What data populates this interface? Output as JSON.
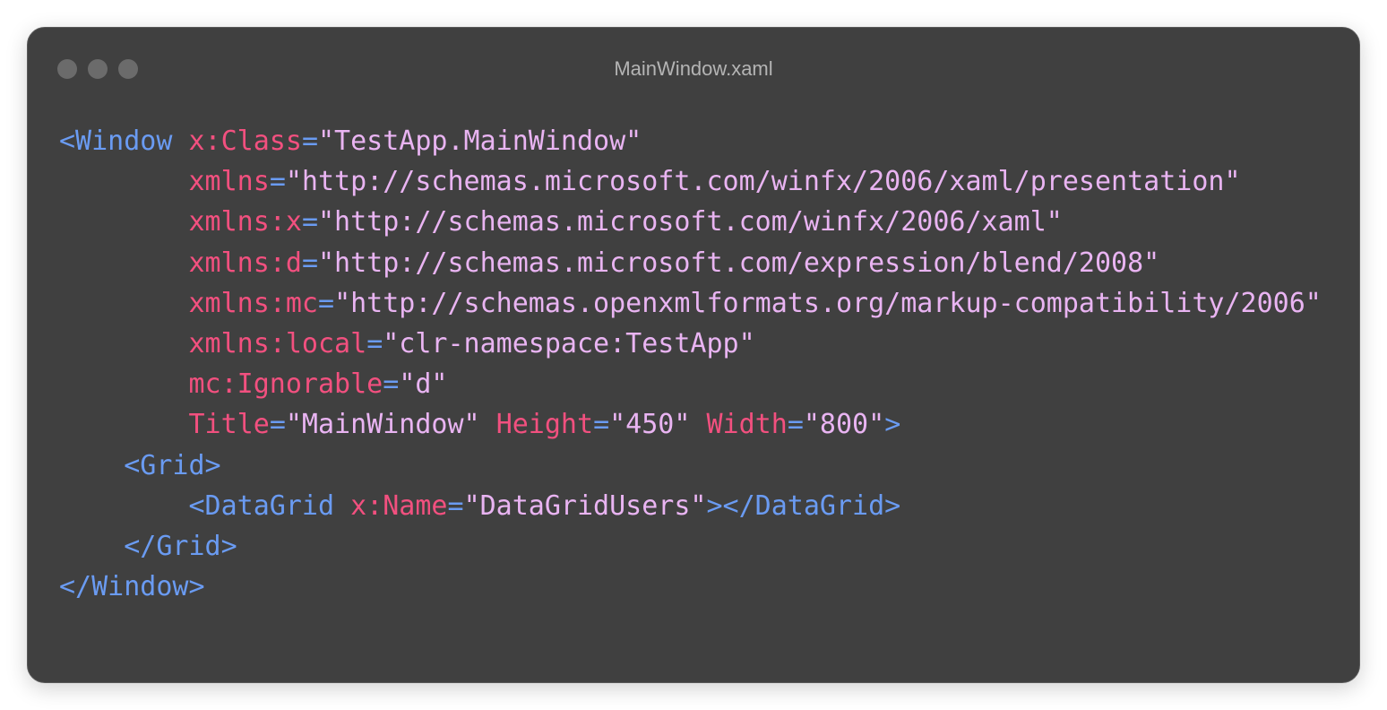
{
  "window": {
    "title": "MainWindow.xaml",
    "controls": [
      "close",
      "minimize",
      "zoom"
    ]
  },
  "colors": {
    "background": "#404040",
    "tag": "#6a9bf2",
    "attribute": "#f2507f",
    "string": "#e9b4f2"
  },
  "code": {
    "lines": [
      {
        "indent": "",
        "tokens": [
          {
            "t": "tag",
            "v": "<Window"
          },
          {
            "t": "ws",
            "v": " "
          },
          {
            "t": "attr",
            "v": "x:Class"
          },
          {
            "t": "eq",
            "v": "="
          },
          {
            "t": "str",
            "v": "\"TestApp.MainWindow\""
          }
        ]
      },
      {
        "indent": "        ",
        "tokens": [
          {
            "t": "attr",
            "v": "xmlns"
          },
          {
            "t": "eq",
            "v": "="
          },
          {
            "t": "str",
            "v": "\"http://schemas.microsoft.com/winfx/2006/xaml/presentation\""
          }
        ]
      },
      {
        "indent": "        ",
        "tokens": [
          {
            "t": "attr",
            "v": "xmlns:x"
          },
          {
            "t": "eq",
            "v": "="
          },
          {
            "t": "str",
            "v": "\"http://schemas.microsoft.com/winfx/2006/xaml\""
          }
        ]
      },
      {
        "indent": "        ",
        "tokens": [
          {
            "t": "attr",
            "v": "xmlns:d"
          },
          {
            "t": "eq",
            "v": "="
          },
          {
            "t": "str",
            "v": "\"http://schemas.microsoft.com/expression/blend/2008\""
          }
        ]
      },
      {
        "indent": "        ",
        "tokens": [
          {
            "t": "attr",
            "v": "xmlns:mc"
          },
          {
            "t": "eq",
            "v": "="
          },
          {
            "t": "str",
            "v": "\"http://schemas.openxmlformats.org/markup-compatibility/2006\""
          }
        ]
      },
      {
        "indent": "        ",
        "tokens": [
          {
            "t": "attr",
            "v": "xmlns:local"
          },
          {
            "t": "eq",
            "v": "="
          },
          {
            "t": "str",
            "v": "\"clr-namespace:TestApp\""
          }
        ]
      },
      {
        "indent": "        ",
        "tokens": [
          {
            "t": "attr",
            "v": "mc:Ignorable"
          },
          {
            "t": "eq",
            "v": "="
          },
          {
            "t": "str",
            "v": "\"d\""
          }
        ]
      },
      {
        "indent": "        ",
        "tokens": [
          {
            "t": "attr",
            "v": "Title"
          },
          {
            "t": "eq",
            "v": "="
          },
          {
            "t": "str",
            "v": "\"MainWindow\""
          },
          {
            "t": "ws",
            "v": " "
          },
          {
            "t": "attr",
            "v": "Height"
          },
          {
            "t": "eq",
            "v": "="
          },
          {
            "t": "str",
            "v": "\"450\""
          },
          {
            "t": "ws",
            "v": " "
          },
          {
            "t": "attr",
            "v": "Width"
          },
          {
            "t": "eq",
            "v": "="
          },
          {
            "t": "str",
            "v": "\"800\""
          },
          {
            "t": "tag",
            "v": ">"
          }
        ]
      },
      {
        "indent": "    ",
        "tokens": [
          {
            "t": "tag",
            "v": "<Grid>"
          }
        ]
      },
      {
        "indent": "        ",
        "tokens": [
          {
            "t": "tag",
            "v": "<DataGrid"
          },
          {
            "t": "ws",
            "v": " "
          },
          {
            "t": "attr",
            "v": "x:Name"
          },
          {
            "t": "eq",
            "v": "="
          },
          {
            "t": "str",
            "v": "\"DataGridUsers\""
          },
          {
            "t": "tag",
            "v": "></DataGrid>"
          }
        ]
      },
      {
        "indent": "    ",
        "tokens": [
          {
            "t": "tag",
            "v": "</Grid>"
          }
        ]
      },
      {
        "indent": "",
        "tokens": [
          {
            "t": "tag",
            "v": "</Window>"
          }
        ]
      }
    ]
  }
}
